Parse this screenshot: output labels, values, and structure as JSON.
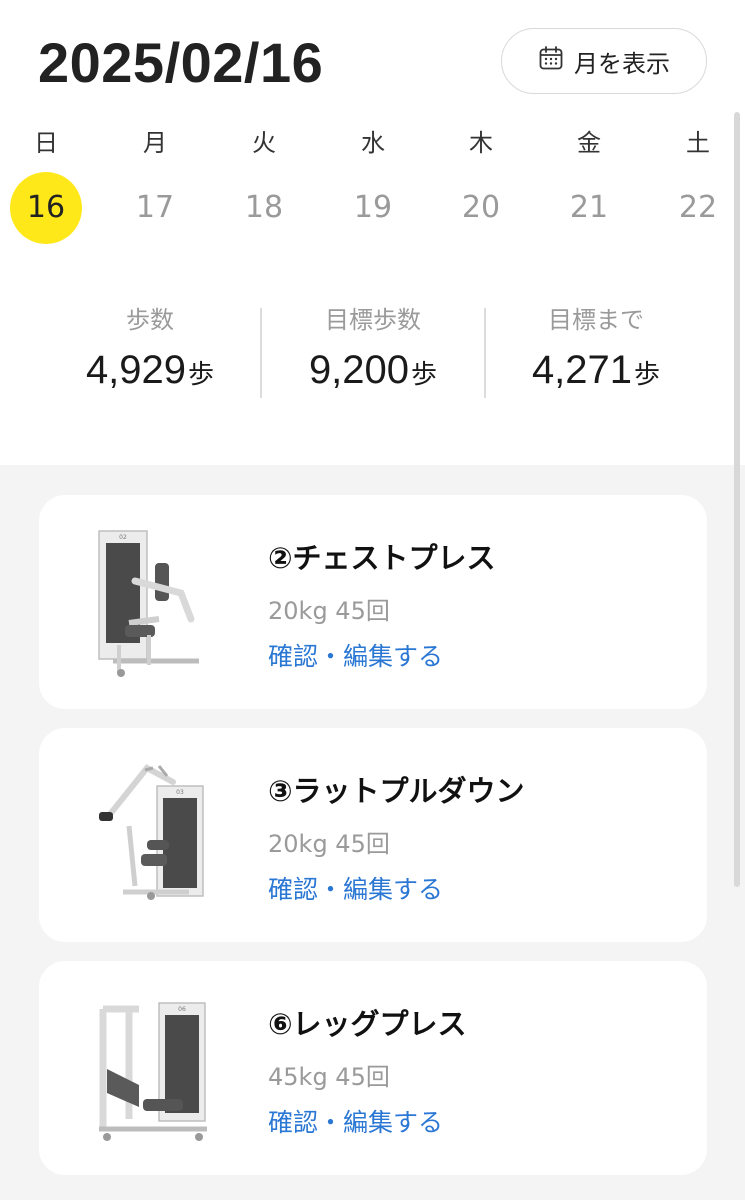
{
  "header": {
    "date": "2025/02/16",
    "month_button_label": "月を表示",
    "month_button_icon": "calendar-icon"
  },
  "week": [
    {
      "weekday": "日",
      "day": "16",
      "selected": true
    },
    {
      "weekday": "月",
      "day": "17",
      "selected": false
    },
    {
      "weekday": "火",
      "day": "18",
      "selected": false
    },
    {
      "weekday": "水",
      "day": "19",
      "selected": false
    },
    {
      "weekday": "木",
      "day": "20",
      "selected": false
    },
    {
      "weekday": "金",
      "day": "21",
      "selected": false
    },
    {
      "weekday": "土",
      "day": "22",
      "selected": false
    }
  ],
  "stats": [
    {
      "label": "歩数",
      "value": "4,929",
      "unit": "歩"
    },
    {
      "label": "目標歩数",
      "value": "9,200",
      "unit": "歩"
    },
    {
      "label": "目標まで",
      "value": "4,271",
      "unit": "歩"
    }
  ],
  "workouts": [
    {
      "name": "②チェストプレス",
      "detail": "20kg 45回",
      "edit_label": "確認・編集する",
      "machine_icon": "chest-press-machine-icon",
      "machine_tag": "02"
    },
    {
      "name": "③ラットプルダウン",
      "detail": "20kg 45回",
      "edit_label": "確認・編集する",
      "machine_icon": "lat-pulldown-machine-icon",
      "machine_tag": "03"
    },
    {
      "name": "⑥レッグプレス",
      "detail": "45kg 45回",
      "edit_label": "確認・編集する",
      "machine_icon": "leg-press-machine-icon",
      "machine_tag": "06"
    }
  ],
  "colors": {
    "selected_day": "#ffe81a",
    "link": "#2b77d4",
    "muted": "#9a9a9a",
    "list_background": "#f4f4f4"
  }
}
